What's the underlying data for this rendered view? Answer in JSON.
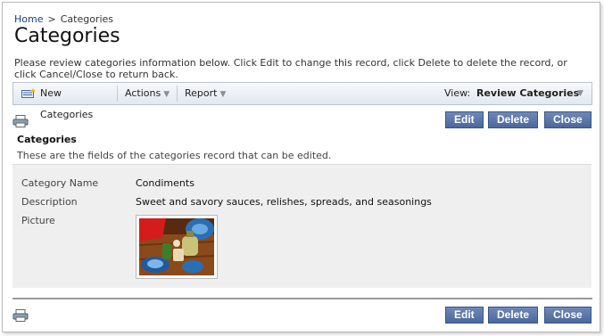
{
  "breadcrumb": {
    "home": "Home",
    "separator": ">",
    "current": "Categories"
  },
  "page": {
    "title": "Categories",
    "intro": "Please review categories information below. Click Edit to change this record, click Delete to delete the record, or click Cancel/Close to return back."
  },
  "toolbar": {
    "new_label": "New Categories",
    "actions_label": "Actions",
    "report_label": "Report",
    "view_label": "View:",
    "view_value": "Review Categories"
  },
  "buttons": {
    "edit": "Edit",
    "delete": "Delete",
    "close": "Close"
  },
  "form": {
    "title": "Categories",
    "description": "These are the fields of the categories record that can be edited.",
    "fields": [
      {
        "label": "Category Name",
        "value": "Condiments"
      },
      {
        "label": "Description",
        "value": "Sweet and savory sauces, relishes, spreads, and seasonings"
      },
      {
        "label": "Picture",
        "value": ""
      }
    ]
  },
  "colors": {
    "button": "#4b679d",
    "toolbar": "#e3e8ef",
    "panel": "#efefef",
    "link": "#1a3c8c"
  },
  "icons": {
    "print": "printer-icon",
    "new": "new-record-icon",
    "chevron": "chevron-down-icon"
  }
}
